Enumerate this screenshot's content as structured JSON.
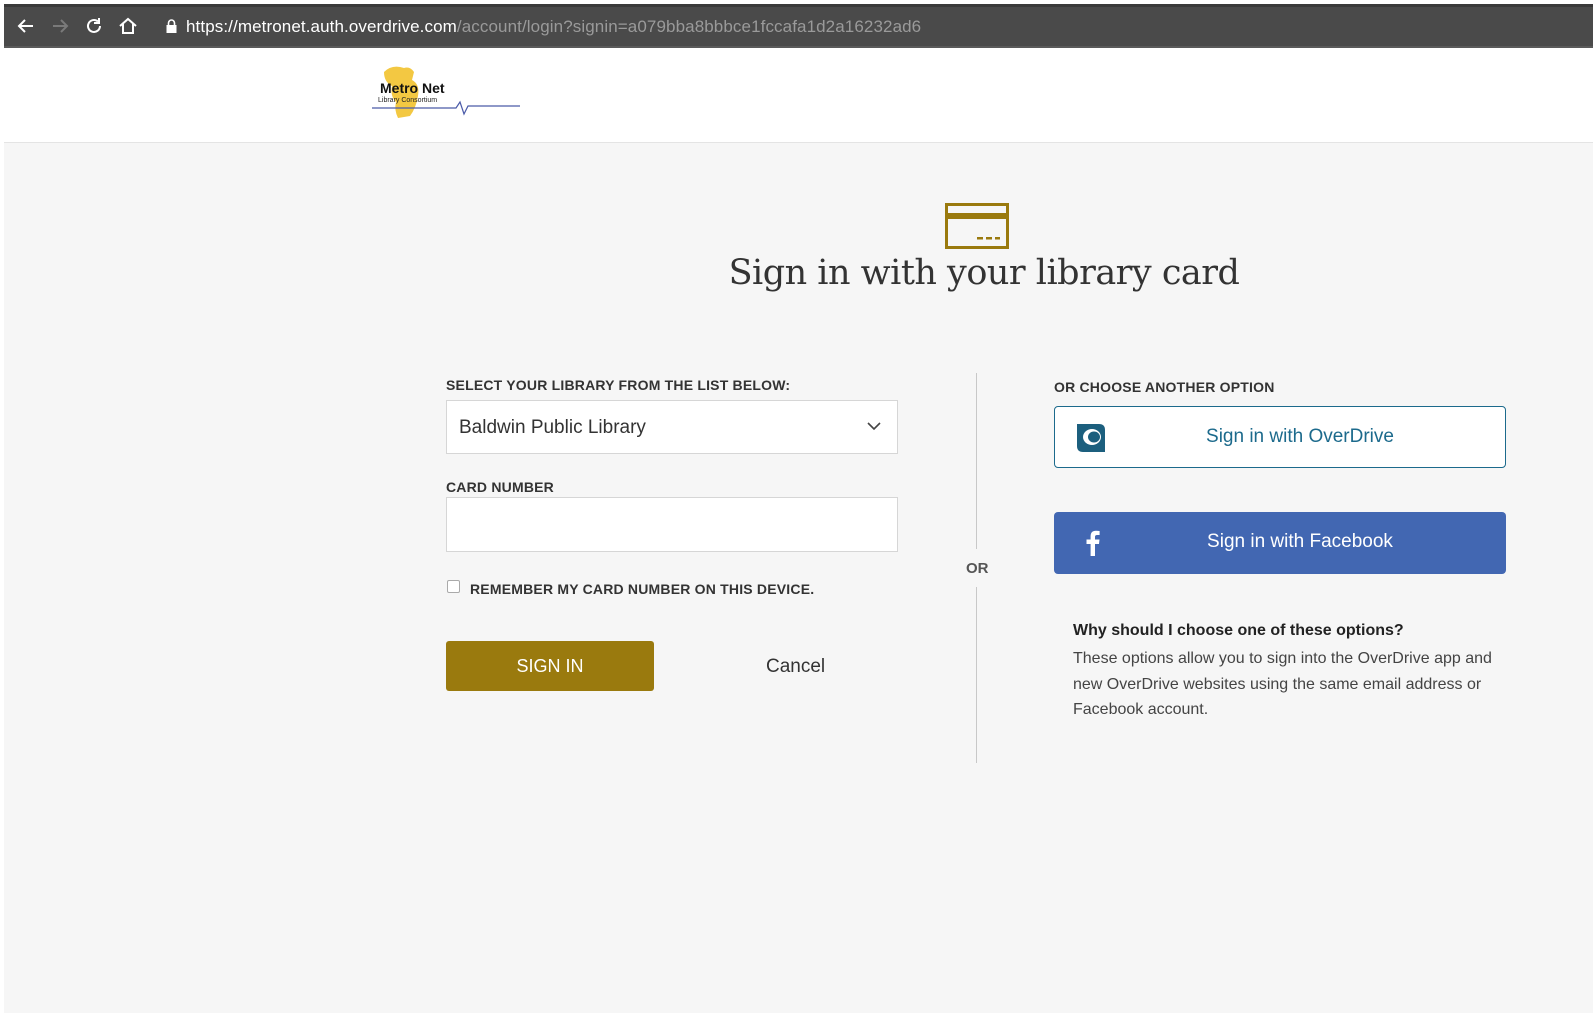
{
  "browser": {
    "url_scheme": "https://",
    "url_host": "metronet.auth.overdrive.com",
    "url_path": "/account/login?signin=a079bba8bbbce1fccafa1d2a16232ad6"
  },
  "header": {
    "logo_title": "Metro Net",
    "logo_subtitle": "Library Consortium"
  },
  "page": {
    "title": "Sign in with your library card"
  },
  "form": {
    "library_label": "SELECT YOUR LIBRARY FROM THE LIST BELOW:",
    "library_selected": "Baldwin Public Library",
    "card_label": "CARD NUMBER",
    "card_value": "",
    "remember_label": "REMEMBER MY CARD NUMBER ON THIS DEVICE.",
    "remember_checked": false,
    "signin_label": "SIGN IN",
    "cancel_label": "Cancel"
  },
  "divider": {
    "or_text": "OR"
  },
  "options": {
    "heading": "OR CHOOSE ANOTHER OPTION",
    "overdrive_label": "Sign in with OverDrive",
    "facebook_label": "Sign in with Facebook",
    "why_title": "Why should I choose one of these options?",
    "why_text": "These options allow you to sign into the OverDrive app and new OverDrive websites using the same email address or Facebook account."
  },
  "colors": {
    "accent_gold": "#9a7a0e",
    "overdrive_blue": "#1c6a8c",
    "facebook_blue": "#4267b2",
    "page_bg": "#f6f6f6"
  },
  "icons": [
    "back-arrow-icon",
    "forward-arrow-icon",
    "reload-icon",
    "home-icon",
    "lock-icon",
    "library-card-icon",
    "chevron-down-icon",
    "overdrive-logo-icon",
    "facebook-f-icon"
  ]
}
